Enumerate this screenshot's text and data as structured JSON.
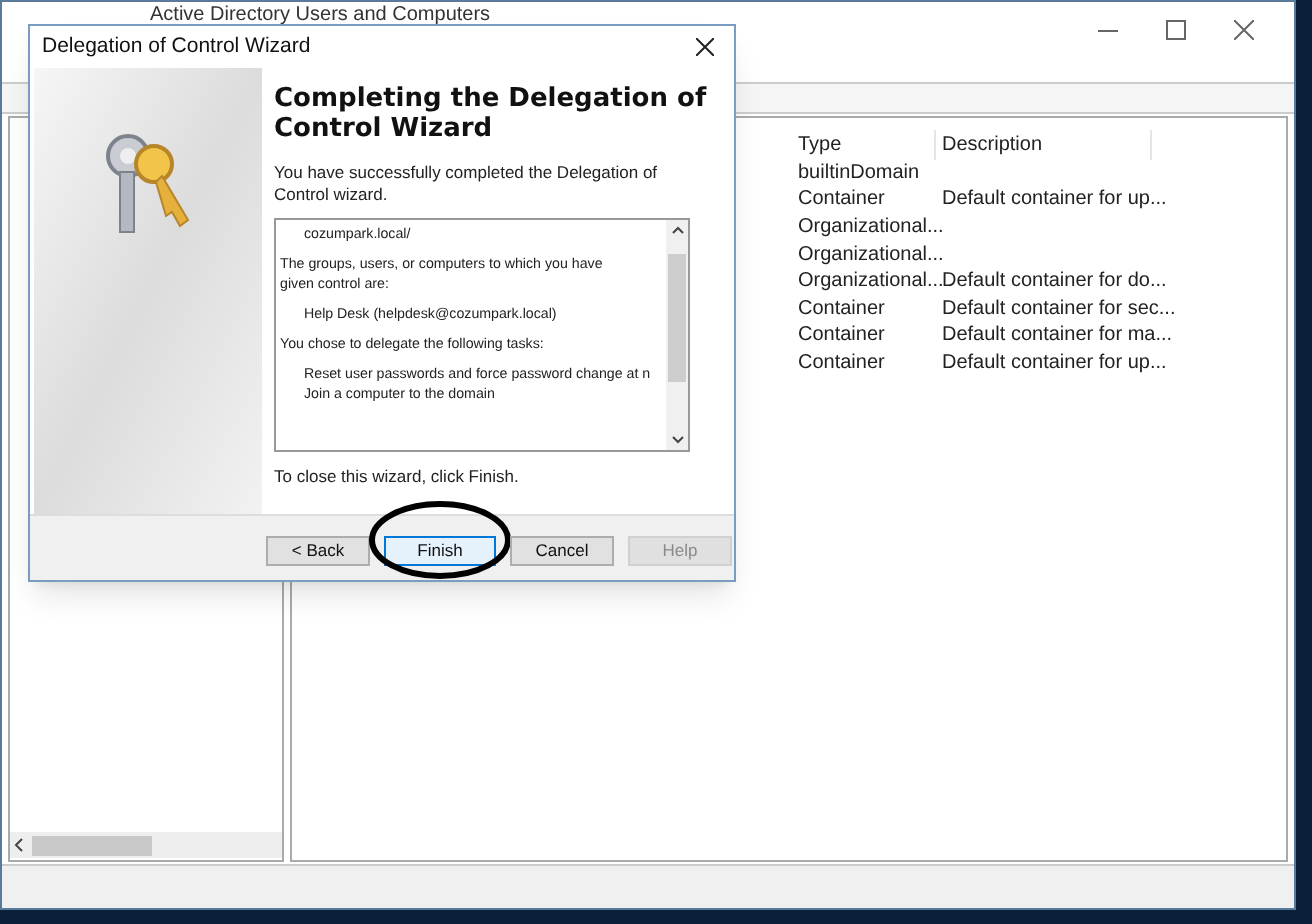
{
  "app_window": {
    "title": "Active Directory Users and Computers"
  },
  "list": {
    "columns": [
      {
        "label": "Type"
      },
      {
        "label": "Description"
      }
    ],
    "rows": [
      {
        "type": "builtinDomain",
        "description": ""
      },
      {
        "type": "Container",
        "description": "Default container for up..."
      },
      {
        "type": "Organizational...",
        "description": ""
      },
      {
        "type": "Organizational...",
        "description": ""
      },
      {
        "type": "Organizational...",
        "description": "Default container for do..."
      },
      {
        "type": "Container",
        "description": "Default container for sec..."
      },
      {
        "type": "Container",
        "description": "Default container for ma..."
      },
      {
        "type": "Container",
        "description": "Default container for up..."
      }
    ]
  },
  "dialog": {
    "title": "Delegation of Control Wizard",
    "heading": "Completing the Delegation of Control Wizard",
    "intro": "You have successfully completed the Delegation of Control wizard.",
    "summary": [
      {
        "kind": "indented",
        "text": "cozumpark.local/"
      },
      {
        "kind": "plain",
        "text": "The groups, users, or computers to which you have given control are:"
      },
      {
        "kind": "indented",
        "text": "Help Desk (helpdesk@cozumpark.local)"
      },
      {
        "kind": "plain",
        "text": "You chose to delegate the following tasks:"
      },
      {
        "kind": "indented",
        "text": "Reset user passwords and force password change at n"
      },
      {
        "kind": "indented-tight",
        "text": "Join a computer to the domain"
      }
    ],
    "footer_note": "To close this wizard, click Finish.",
    "buttons": [
      {
        "label": "< Back",
        "disabled": false,
        "focused": false,
        "circled": false
      },
      {
        "label": "Finish",
        "disabled": false,
        "focused": true,
        "circled": true
      },
      {
        "label": "Cancel",
        "disabled": false,
        "focused": false,
        "circled": false
      },
      {
        "label": "Help",
        "disabled": true,
        "focused": false,
        "circled": false
      }
    ]
  }
}
